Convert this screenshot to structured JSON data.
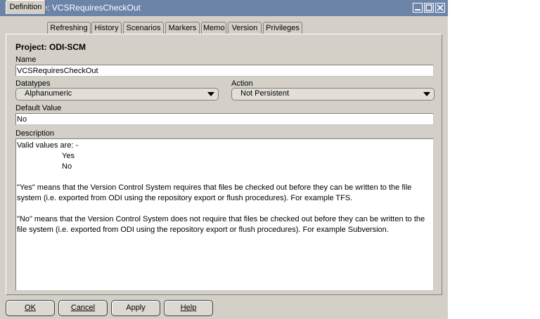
{
  "window": {
    "title": "Variable: VCSRequiresCheckOut",
    "icon": "question-mark-icon"
  },
  "title_buttons": {
    "minimize": "minimize-icon",
    "maximize": "maximize-icon",
    "close": "close-icon"
  },
  "tabs": [
    {
      "label": "Definition",
      "active": true
    },
    {
      "label": "Refreshing",
      "active": false
    },
    {
      "label": "History",
      "active": false
    },
    {
      "label": "Scenarios",
      "active": false
    },
    {
      "label": "Markers",
      "active": false
    },
    {
      "label": "Memo",
      "active": false
    },
    {
      "label": "Version",
      "active": false
    },
    {
      "label": "Privileges",
      "active": false
    }
  ],
  "form": {
    "project_label": "Project: ODI-SCM",
    "name_label": "Name",
    "name_value": "VCSRequiresCheckOut",
    "datatypes_label": "Datatypes",
    "datatypes_value": "Alphanumeric",
    "action_label": "Action",
    "action_value": "Not Persistent",
    "default_value_label": "Default Value",
    "default_value": "No",
    "description_label": "Description",
    "description_lines": {
      "l1": "Valid values are: -",
      "l2": "Yes",
      "l3": "No",
      "l4": "\"Yes\" means that the Version Control System requires that files be checked out before they can be written to the file",
      "l5": "system (i.e. exported from ODI using the repository export or flush procedures). For example TFS.",
      "l6": "\"No\" means that the Version Control System does not require that files be checked out before they can be written to the",
      "l7": "file system (i.e. exported from ODI using the repository export or flush procedures). For example Subversion."
    }
  },
  "buttons": {
    "ok": "OK",
    "cancel": "Cancel",
    "apply": "Apply",
    "help": "Help"
  },
  "colors": {
    "title_bar": "#6b84a8",
    "window_bg": "#d4d0c8",
    "field_bg": "#ffffff"
  }
}
